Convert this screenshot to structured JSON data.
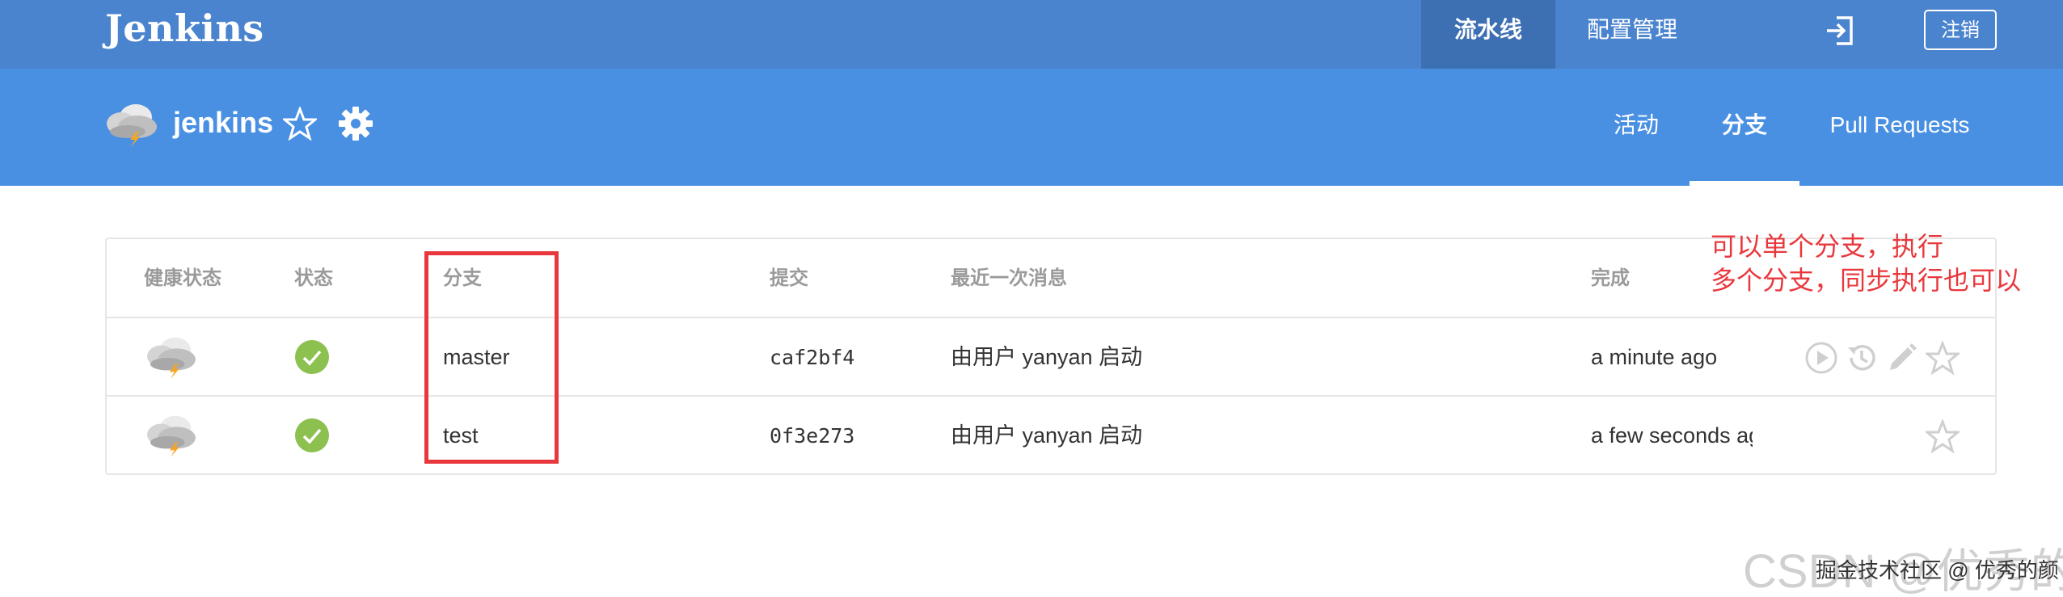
{
  "topbar": {
    "logo": "Jenkins",
    "nav": [
      "流水线",
      "配置管理"
    ],
    "logout_label": "注销"
  },
  "pipeline": {
    "name": "jenkins",
    "tabs": [
      "活动",
      "分支",
      "Pull Requests"
    ],
    "active_tab": "分支"
  },
  "table": {
    "headers": {
      "health": "健康状态",
      "status": "状态",
      "branch": "分支",
      "commit": "提交",
      "message": "最近一次消息",
      "completed": "完成"
    },
    "rows": [
      {
        "health_icon": "weather-stormy-icon",
        "status_icon": "success-check-icon",
        "branch": "master",
        "commit": "caf2bf4",
        "message": "由用户 yanyan 启动",
        "completed": "a minute ago"
      },
      {
        "health_icon": "weather-stormy-icon",
        "status_icon": "success-check-icon",
        "branch": "test",
        "commit": "0f3e273",
        "message": "由用户 yanyan 启动",
        "completed": "a few seconds ag"
      }
    ]
  },
  "annotation": {
    "lines": [
      "可以单个分支，执行",
      "多个分支，同步执行也可以"
    ]
  },
  "watermark": {
    "background": "CSDN @优秀的颜",
    "foreground": "掘金技术社区 @ 优秀的颜"
  },
  "colors": {
    "topbar": "#4a83ce",
    "subheader": "#4a90e2",
    "success": "#8cc04f",
    "annotation": "#e8383d"
  }
}
